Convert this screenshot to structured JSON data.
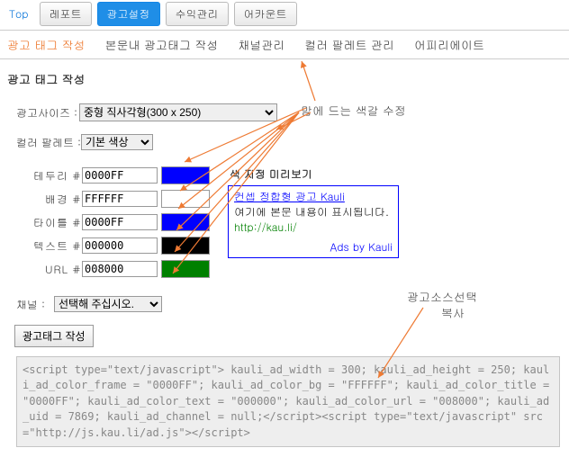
{
  "top": {
    "link": "Top"
  },
  "tabs": {
    "report": "레포트",
    "ad_settings": "광고설정",
    "revenue": "수익관리",
    "account": "어카운트"
  },
  "subtabs": {
    "create_tag": "광고 태그 작성",
    "body_tag": "본문내 광고태그 작성",
    "channel": "채널관리",
    "palette": "컬러 팔레트 관리",
    "affiliate": "어피리에이트"
  },
  "page_title": "광고 태그 작성",
  "labels": {
    "size": "광고사이즈 :",
    "palette": "컬러 팔레트 :",
    "border": "테두리",
    "bg": "배경",
    "title": "타이틀",
    "text": "텍스트",
    "url": "URL",
    "channel": "채널 :"
  },
  "size_selected": "중형 직사각형(300 x 250)",
  "palette_selected": "기본 색상",
  "colors": {
    "border": "0000FF",
    "bg": "FFFFFF",
    "title": "0000FF",
    "text": "000000",
    "url": "008000"
  },
  "preview": {
    "head": "색 지정 미리보기",
    "title": "컨셉 정합형 광고 Kauli",
    "text": "여기에 본문 내용이 표시됩니다.",
    "url": "http://kau.li/",
    "ads": "Ads by Kauli"
  },
  "channel_selected": "선택해 주십시오.",
  "button": "광고태그 작성",
  "code": "<script type=\"text/javascript\"> kauli_ad_width = 300; kauli_ad_height = 250; kauli_ad_color_frame = \"0000FF\"; kauli_ad_color_bg = \"FFFFFF\"; kauli_ad_color_title = \"0000FF\"; kauli_ad_color_text = \"000000\"; kauli_ad_color_url = \"008000\"; kauli_ad_uid = 7869; kauli_ad_channel = null;</script><script type=\"text/javascript\" src=\"http://js.kau.li/ad.js\"></script>",
  "annotations": {
    "color_note": "맘에 드는 색갈 수정",
    "source_note1": "광고소스선택",
    "source_note2": "복사"
  }
}
